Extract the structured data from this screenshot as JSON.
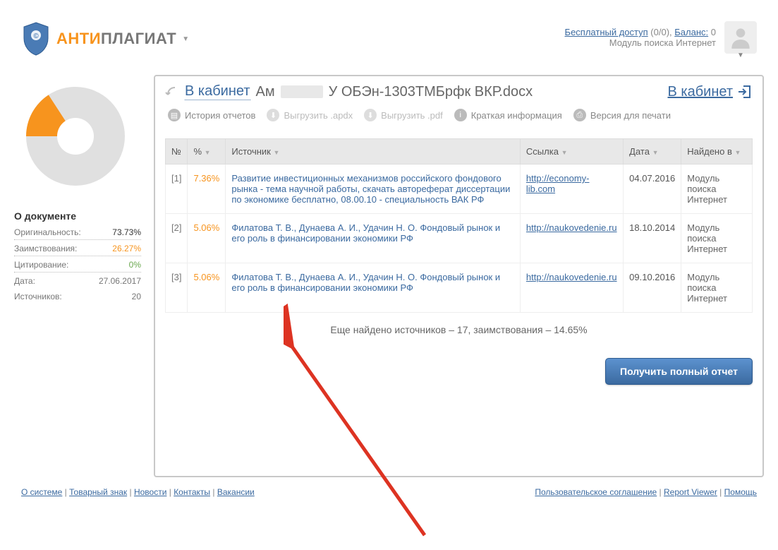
{
  "header": {
    "logo_anti": "АНТИ",
    "logo_plag": "ПЛАГИАТ",
    "free_access": "Бесплатный доступ",
    "free_access_val": "(0/0),",
    "balance": "Баланс:",
    "balance_val": "0",
    "module_line": "Модуль поиска Интернет"
  },
  "sidebar": {
    "title": "О документе",
    "orig_label": "Оригинальность:",
    "orig_val": "73.73%",
    "borrow_label": "Заимствования:",
    "borrow_val": "26.27%",
    "cite_label": "Цитирование:",
    "cite_val": "0%",
    "date_label": "Дата:",
    "date_val": "27.06.2017",
    "sources_label": "Источников:",
    "sources_val": "20"
  },
  "content_head": {
    "back_link": "В кабинет",
    "doc_prefix": "Ам",
    "doc_suffix": "У ОБЭн-1303ТМБрфк ВКР.docx",
    "cab_link": "В кабинет"
  },
  "toolbar": {
    "history": "История отчетов",
    "export_apdx": "Выгрузить .apdx",
    "export_pdf": "Выгрузить .pdf",
    "brief": "Краткая информация",
    "print": "Версия для печати"
  },
  "table": {
    "h_num": "№",
    "h_pct": "%",
    "h_src": "Источник",
    "h_link": "Ссылка",
    "h_date": "Дата",
    "h_found": "Найдено в",
    "rows": [
      {
        "n": "[1]",
        "p": "7.36%",
        "src": "Развитие инвестиционных механизмов российского фондового рынка - тема научной работы, скачать автореферат диссертации по экономике бесплатно, 08.00.10 - специальность ВАК РФ",
        "link": "http://economy-lib.com",
        "date": "04.07.2016",
        "mod": "Модуль поиска Интернет"
      },
      {
        "n": "[2]",
        "p": "5.06%",
        "src": "Филатова Т. В., Дунаева А. И., Удачин Н. О. Фондовый рынок и его роль в финансировании экономики РФ",
        "link": "http://naukovedenie.ru",
        "date": "18.10.2014",
        "mod": "Модуль поиска Интернет"
      },
      {
        "n": "[3]",
        "p": "5.06%",
        "src": "Филатова Т. В., Дунаева А. И., Удачин Н. О. Фондовый рынок и его роль в финансировании экономики РФ",
        "link": "http://naukovedenie.ru",
        "date": "09.10.2016",
        "mod": "Модуль поиска Интернет"
      }
    ],
    "more": "Еще найдено источников – 17, заимствования – 14.65%"
  },
  "buttons": {
    "full_report": "Получить полный отчет"
  },
  "footer": {
    "left": [
      "О системе",
      "Товарный знак",
      "Новости",
      "Контакты",
      "Вакансии"
    ],
    "right": [
      "Пользовательское соглашение",
      "Report Viewer",
      "Помощь"
    ]
  },
  "chart_data": {
    "type": "pie",
    "title": "",
    "categories": [
      "Оригинальность",
      "Заимствования",
      "Цитирование"
    ],
    "values": [
      73.73,
      26.27,
      0
    ],
    "colors": [
      "#e0e0e0",
      "#f7941e",
      "#6aa84f"
    ]
  }
}
